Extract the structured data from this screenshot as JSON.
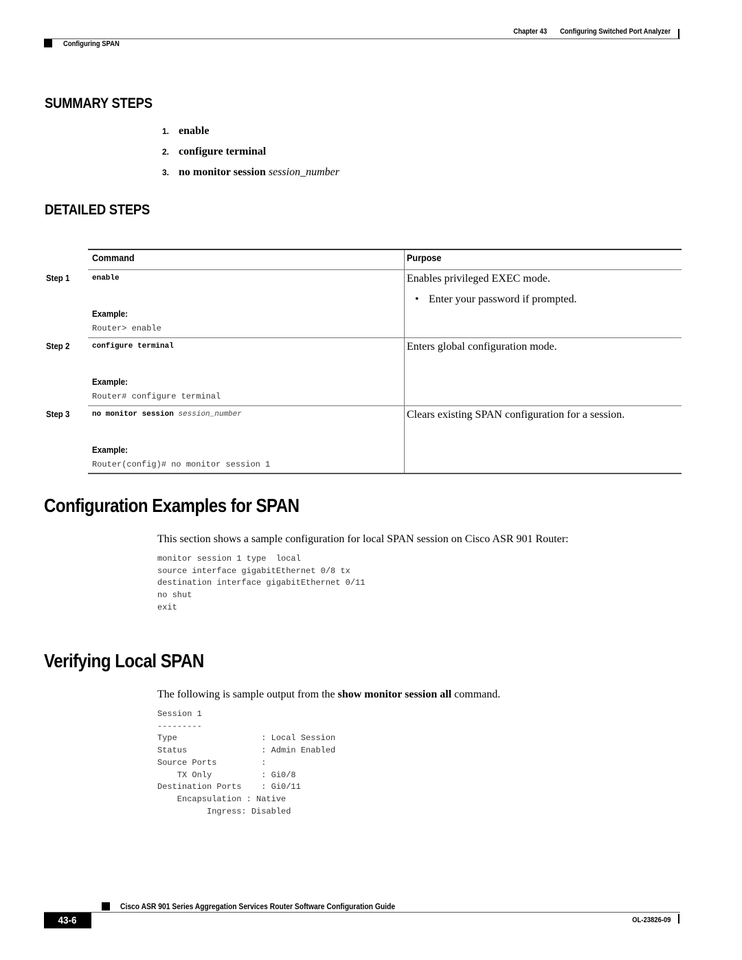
{
  "header": {
    "chapter": "Chapter 43",
    "chapter_title": "Configuring Switched Port Analyzer",
    "section": "Configuring SPAN"
  },
  "summary_steps": {
    "heading": "SUMMARY STEPS",
    "items": [
      {
        "num": "1.",
        "command": "enable",
        "arg": ""
      },
      {
        "num": "2.",
        "command": "configure terminal",
        "arg": ""
      },
      {
        "num": "3.",
        "command": "no monitor session",
        "arg": "session_number"
      }
    ]
  },
  "detailed_steps": {
    "heading": "DETAILED STEPS",
    "columns": {
      "command": "Command",
      "purpose": "Purpose"
    },
    "example_label": "Example:",
    "rows": [
      {
        "step": "Step 1",
        "command": "enable",
        "arg": "",
        "example": "Router> enable",
        "purpose": "Enables privileged EXEC mode.",
        "bullets": [
          "Enter your password if prompted."
        ]
      },
      {
        "step": "Step 2",
        "command": "configure terminal",
        "arg": "",
        "example": "Router# configure terminal",
        "purpose": "Enters global configuration mode.",
        "bullets": []
      },
      {
        "step": "Step 3",
        "command": "no monitor session",
        "arg": "session_number",
        "example": "Router(config)# no monitor session 1",
        "purpose": "Clears existing SPAN configuration for a session.",
        "bullets": []
      }
    ]
  },
  "config_examples": {
    "heading": "Configuration Examples for SPAN",
    "intro": "This section shows a sample configuration for local SPAN session on Cisco ASR 901 Router:",
    "code": "monitor session 1 type  local\nsource interface gigabitEthernet 0/8 tx\ndestination interface gigabitEthernet 0/11\nno shut\nexit"
  },
  "verifying": {
    "heading": "Verifying Local SPAN",
    "intro_pre": "The following is sample output from the ",
    "intro_cmd": "show monitor session all",
    "intro_post": " command.",
    "code": "Session 1\n---------\nType                 : Local Session\nStatus               : Admin Enabled\nSource Ports         :\n    TX Only          : Gi0/8\nDestination Ports    : Gi0/11\n    Encapsulation : Native\n          Ingress: Disabled"
  },
  "footer": {
    "guide_title": "Cisco ASR 901 Series Aggregation Services Router Software Configuration Guide",
    "page_number": "43-6",
    "doc_number": "OL-23826-09"
  }
}
